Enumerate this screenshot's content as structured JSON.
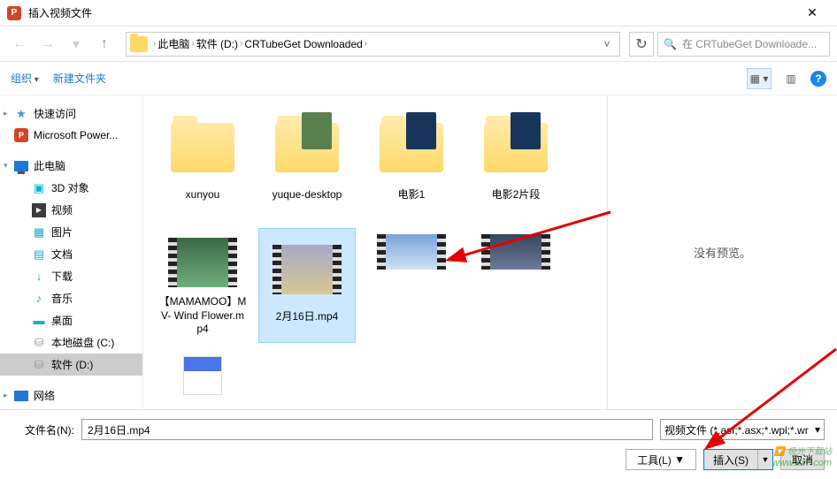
{
  "titlebar": {
    "app_badge": "P",
    "title": "插入视频文件"
  },
  "navbar": {
    "breadcrumb": [
      "此电脑",
      "软件 (D:)",
      "CRTubeGet Downloaded"
    ],
    "search_placeholder": "在 CRTubeGet Downloade..."
  },
  "toolbar": {
    "organize": "组织",
    "new_folder": "新建文件夹"
  },
  "sidebar": {
    "items": [
      {
        "label": "快速访问",
        "ico": "star",
        "expand": "▸"
      },
      {
        "label": "Microsoft Power...",
        "ico": "pp"
      },
      {
        "gap": true
      },
      {
        "label": "此电脑",
        "ico": "pc",
        "expand": "▾"
      },
      {
        "label": "3D 对象",
        "ico": "3d",
        "lvl": 2
      },
      {
        "label": "视频",
        "ico": "video",
        "lvl": 2
      },
      {
        "label": "图片",
        "ico": "pic",
        "lvl": 2
      },
      {
        "label": "文档",
        "ico": "doc",
        "lvl": 2
      },
      {
        "label": "下载",
        "ico": "dl",
        "lvl": 2
      },
      {
        "label": "音乐",
        "ico": "music",
        "lvl": 2
      },
      {
        "label": "桌面",
        "ico": "desk",
        "lvl": 2
      },
      {
        "label": "本地磁盘 (C:)",
        "ico": "disk",
        "lvl": 2
      },
      {
        "label": "软件 (D:)",
        "ico": "disk",
        "lvl": 2,
        "selected": true
      },
      {
        "gap": true
      },
      {
        "label": "网络",
        "ico": "net",
        "expand": "▸"
      }
    ]
  },
  "files": [
    {
      "name": "xunyou",
      "type": "folder"
    },
    {
      "name": "yuque-desktop",
      "type": "folder",
      "peek": "1"
    },
    {
      "name": "电影1",
      "type": "folder",
      "peek": "2"
    },
    {
      "name": "电影2片段",
      "type": "folder",
      "peek": "2"
    },
    {
      "name": "【MAMAMOO】MV- Wind Flower.mp4",
      "type": "video",
      "vt": "1"
    },
    {
      "name": "2月16日.mp4",
      "type": "video",
      "vt": "2",
      "selected": true
    },
    {
      "name": "",
      "type": "video",
      "vt": "3",
      "partial": true
    },
    {
      "name": "",
      "type": "video",
      "vt": "4",
      "partial": true
    },
    {
      "name": "",
      "type": "phone",
      "partial": true
    }
  ],
  "preview": {
    "text": "没有预览。"
  },
  "bottom": {
    "filename_label": "文件名(N):",
    "filename_value": "2月16日.mp4",
    "filter": "视频文件 (*.asf;*.asx;*.wpl;*.wr",
    "tools": "工具(L)",
    "insert": "插入(S)",
    "cancel": "取消"
  },
  "watermark": {
    "cn": "🔽 极光下载站",
    "url": "www.xz7.com"
  }
}
